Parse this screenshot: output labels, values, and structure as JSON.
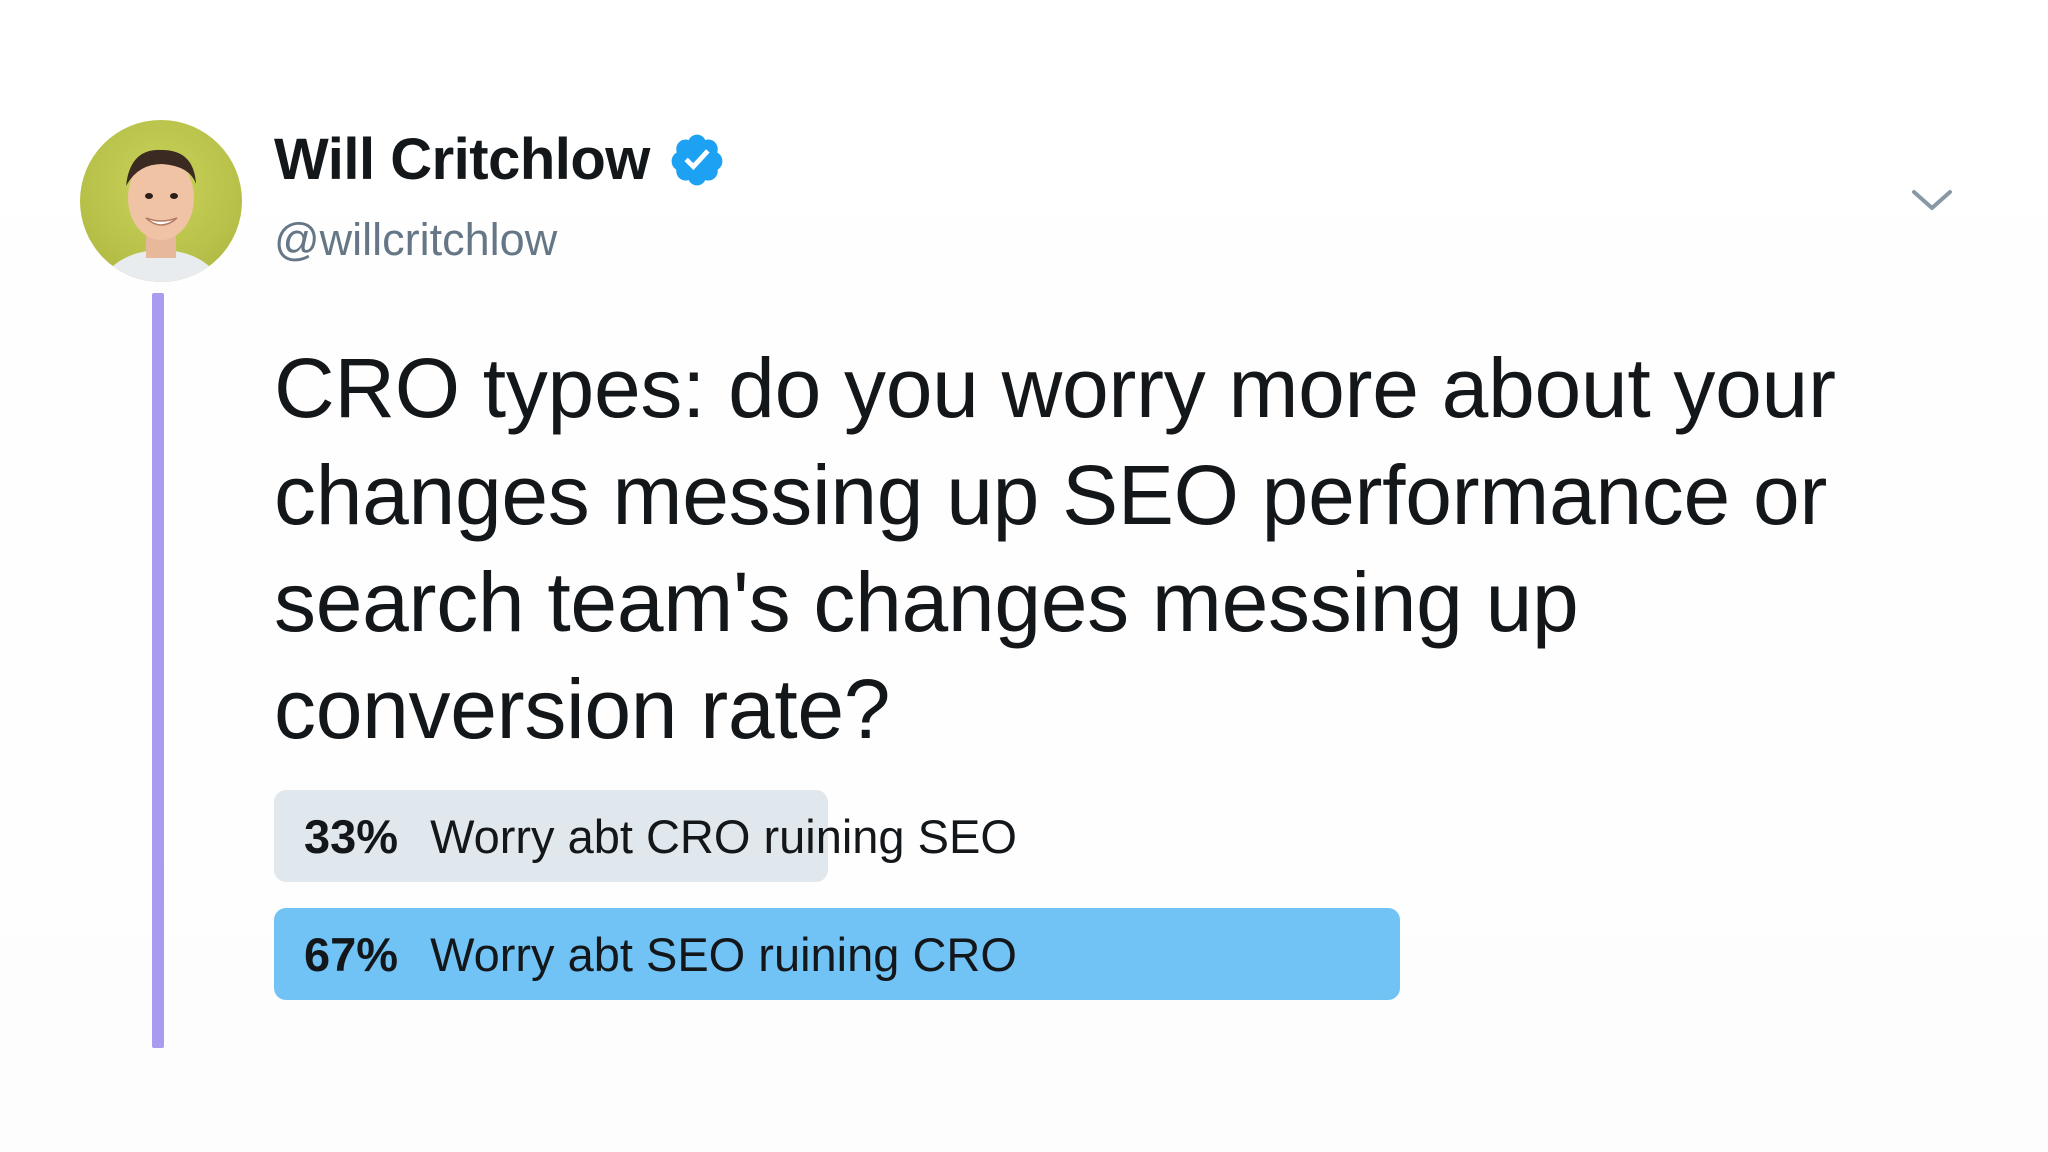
{
  "tweet": {
    "author": {
      "display_name": "Will Critchlow",
      "handle": "@willcritchlow",
      "verified": true
    },
    "text": "CRO types: do you worry more about your changes messing up SEO performance or search team's changes messing up conversion rate?",
    "poll": {
      "options": [
        {
          "percent_label": "33%",
          "percent": 33,
          "label": "Worry abt CRO ruining SEO",
          "winner": false
        },
        {
          "percent_label": "67%",
          "percent": 67,
          "label": "Worry abt SEO ruining CRO",
          "winner": true
        }
      ]
    }
  },
  "colors": {
    "thread_line": "#a99cf0",
    "verified_badge": "#1da1f2",
    "poll_winner": "#71c3f6",
    "poll_loser": "#e1e8ed",
    "handle_text": "#657786"
  },
  "icons": {
    "verified": "verified-badge-icon",
    "menu": "chevron-down-icon"
  }
}
